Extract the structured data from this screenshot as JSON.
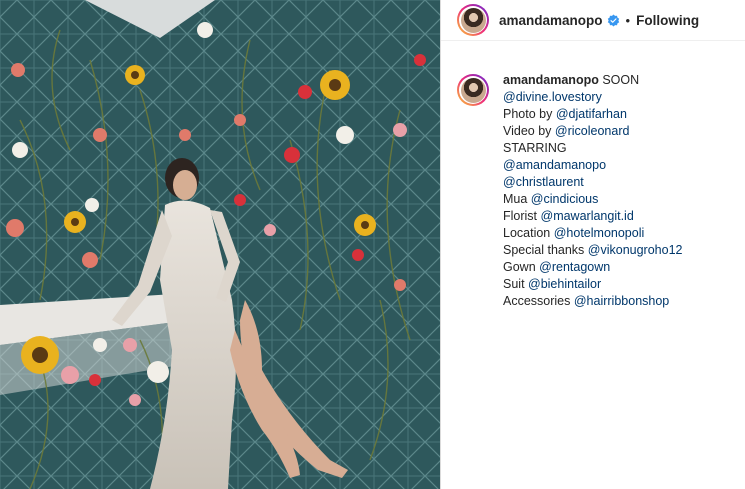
{
  "post": {
    "username": "amandamanopo",
    "verified": true,
    "separator": "•",
    "follow_status": "Following"
  },
  "caption": {
    "username": "amandamanopo",
    "first_text": "SOON",
    "lines": [
      {
        "text": "",
        "mention": "@divine.lovestory"
      },
      {
        "text": "Photo by ",
        "mention": "@djatifarhan"
      },
      {
        "text": "Video by ",
        "mention": "@ricoleonard"
      },
      {
        "text": "STARRING",
        "mention": ""
      },
      {
        "text": "",
        "mention": "@amandamanopo"
      },
      {
        "text": "",
        "mention": "@christlaurent"
      },
      {
        "text": "Mua ",
        "mention": "@cindicious"
      },
      {
        "text": "Florist ",
        "mention": "@mawarlangit.id"
      },
      {
        "text": "Location ",
        "mention": "@hotelmonopoli"
      },
      {
        "text": "Special thanks ",
        "mention": "@vikonugroho12"
      },
      {
        "text": "Gown ",
        "mention": "@rentagown"
      },
      {
        "text": "Suit ",
        "mention": "@biehintailor"
      },
      {
        "text": "Accessories ",
        "mention": "@hairribbonshop"
      }
    ]
  },
  "colors": {
    "verified_badge": "#3897f0",
    "mention": "#00376b",
    "tile_wall": "#2f5a5e"
  }
}
